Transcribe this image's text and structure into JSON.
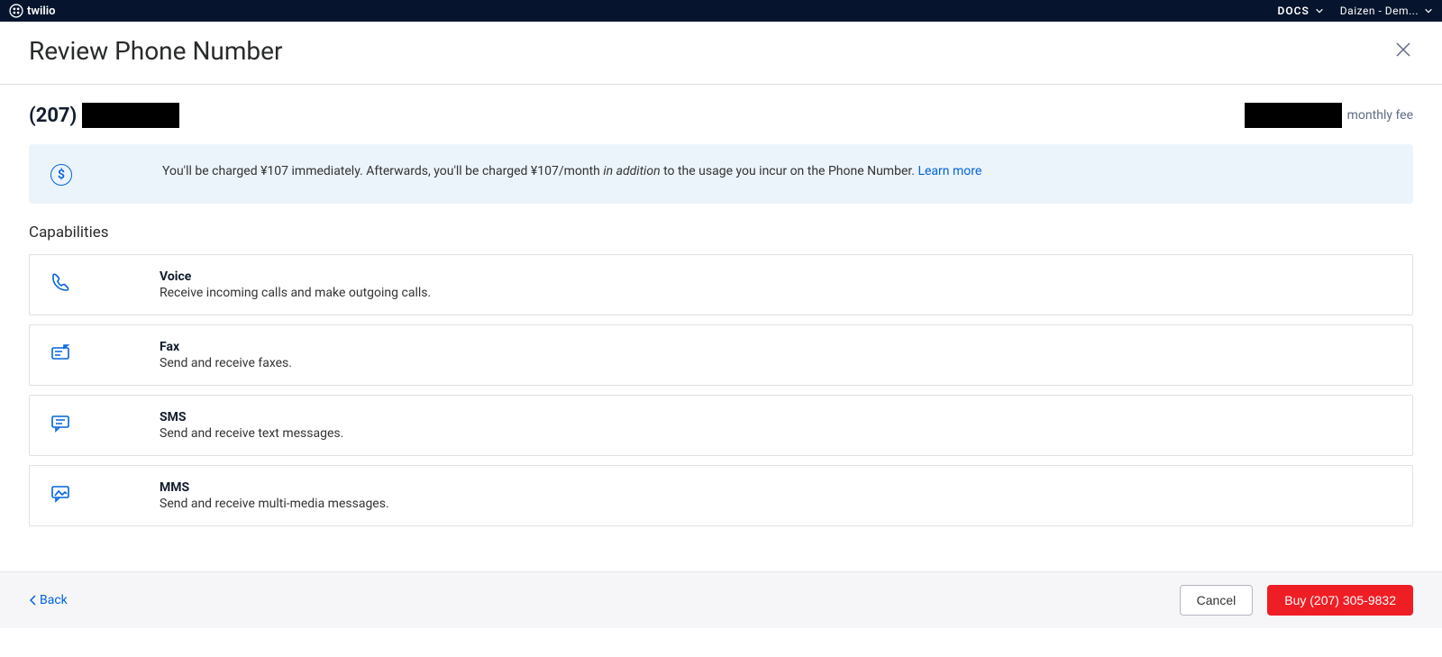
{
  "topbar": {
    "brand": "twilio",
    "docs_label": "DOCS",
    "account_label": "Daizen - Dem..."
  },
  "header": {
    "title": "Review Phone Number"
  },
  "phone": {
    "area_code_display": "(207)",
    "fee_label": "monthly fee"
  },
  "banner": {
    "text_1": "You'll be charged ¥107 immediately. Afterwards, you'll be charged  ¥107/month ",
    "italic": "in addition",
    "text_2": " to the usage you incur on the Phone Number. ",
    "learn_more": "Learn more"
  },
  "capabilities_label": "Capabilities",
  "capabilities": [
    {
      "title": "Voice",
      "desc": "Receive incoming calls and make outgoing calls."
    },
    {
      "title": "Fax",
      "desc": "Send and receive faxes."
    },
    {
      "title": "SMS",
      "desc": "Send and receive text messages."
    },
    {
      "title": "MMS",
      "desc": "Send and receive multi-media messages."
    }
  ],
  "footer": {
    "back": "Back",
    "cancel": "Cancel",
    "buy": "Buy (207) 305-9832"
  }
}
